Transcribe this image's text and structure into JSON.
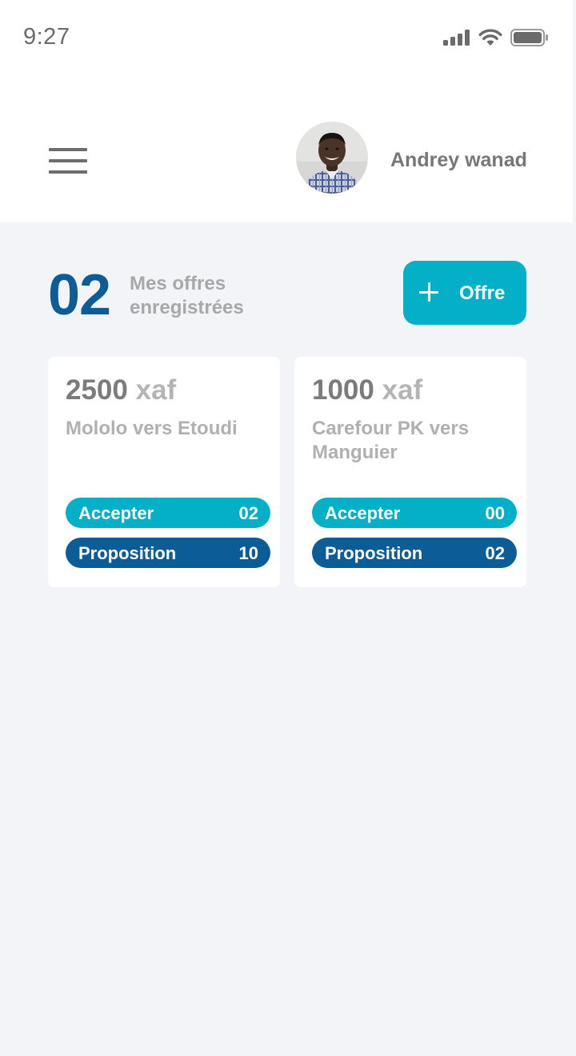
{
  "status_bar": {
    "time": "9:27"
  },
  "header": {
    "user_name": "Andrey wanad"
  },
  "summary": {
    "count": "02",
    "label": "Mes offres enregistrées",
    "add_button_label": "Offre"
  },
  "offers": [
    {
      "amount": "2500",
      "currency": "xaf",
      "route": "Mololo vers Etoudi",
      "accept_label": "Accepter",
      "accept_count": "02",
      "proposal_label": "Proposition",
      "proposal_count": "10"
    },
    {
      "amount": "1000",
      "currency": "xaf",
      "route": "Carefour PK vers Manguier",
      "accept_label": "Accepter",
      "accept_count": "00",
      "proposal_label": "Proposition",
      "proposal_count": "02"
    }
  ],
  "colors": {
    "primary_dark": "#0c5d97",
    "primary_light": "#04b0c8",
    "background": "#f2f4f8",
    "card": "#ffffff"
  },
  "icons": {
    "menu": "hamburger-menu-icon",
    "signal": "cellular-signal-icon",
    "wifi": "wifi-icon",
    "battery": "battery-icon",
    "add": "plus-icon"
  }
}
